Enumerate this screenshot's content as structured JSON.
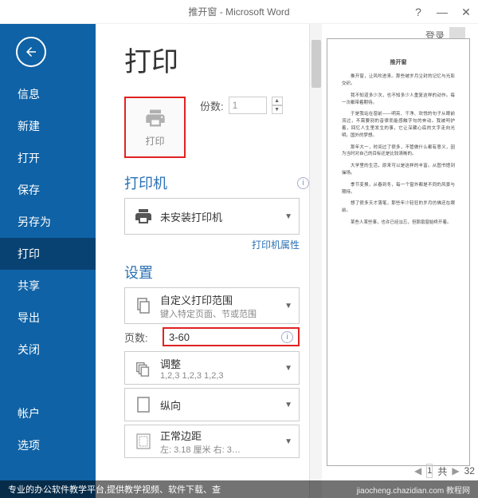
{
  "titlebar": {
    "title": "推开窗 - Microsoft Word",
    "help": "?",
    "min": "—",
    "close": "✕"
  },
  "signin": {
    "label": "登录"
  },
  "nav": {
    "items": [
      "信息",
      "新建",
      "打开",
      "保存",
      "另存为",
      "打印",
      "共享",
      "导出",
      "关闭"
    ],
    "bottom": [
      "帐户",
      "选项"
    ],
    "active_index": 5
  },
  "print": {
    "page_title": "打印",
    "button_label": "打印",
    "copies_label": "份数:",
    "copies_value": "1"
  },
  "printer": {
    "section_title": "打印机",
    "device": "未安装打印机",
    "properties_link": "打印机属性"
  },
  "settings": {
    "section_title": "设置",
    "range": {
      "main": "自定义打印范围",
      "sub": "键入特定页面、节或范围"
    },
    "pages_label": "页数:",
    "pages_value": "3-60",
    "collate": {
      "main": "调整",
      "sub": "1,2,3    1,2,3    1,2,3"
    },
    "orientation": {
      "main": "纵向",
      "sub": ""
    },
    "margins": {
      "main": "正常边距",
      "sub": "左: 3.18 厘米    右: 3…"
    }
  },
  "pager": {
    "prev": "◀",
    "current": "1",
    "total_label": "共",
    "next": "▶",
    "zoom_area": "32"
  },
  "watermark": {
    "left": "专业的办公软件教学平台,提供教学视频、软件下载、查",
    "right": "jiaocheng.chazidian.com 教程网"
  },
  "preview_text": {
    "title": "推开窗",
    "p1": "推开窗，让风吹进来。那些被岁月尘封的记忆与光影交织。",
    "p2": "我不知道多少次，也不知多少人重复这样的动作。每一次都带着期待。",
    "p3": "于是我站在窗前——明亮、干净、欢悦的句子从眼前流过，不需要别的音律而能感触字句的奔动。我被呵护着，回忆人生里发生的事，它让深藏心底的文字走向光明。国外的梦想。",
    "p4": "那年大一，时间过了很多，不管做什么都有意义，因为当时对自己的目标还是比较清晰的。",
    "p5": "大学里的生活，原来可以是这样的丰富。从图书馆到操场。",
    "p6": "季节变换，从春到冬，每一个窗外都是不同的风景与期待。",
    "p7": "想了很多天才落笔，那些年少轻狂的岁月仿佛还在眼前。",
    "p8": "某些人某些事，也许已经淡忘，但那扇窗始终开着。"
  }
}
